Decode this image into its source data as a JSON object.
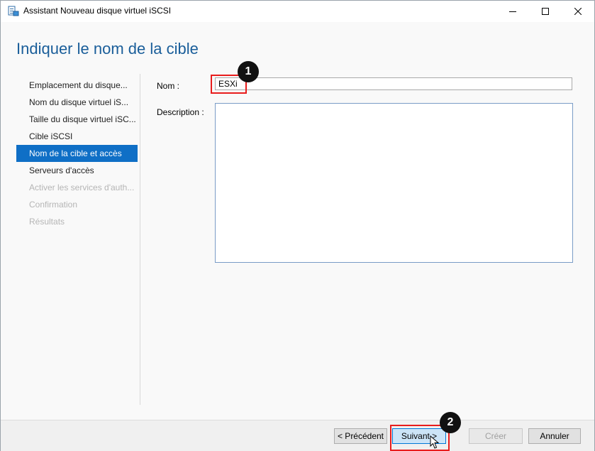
{
  "window": {
    "title": "Assistant Nouveau disque virtuel iSCSI",
    "icon": "iscsi-wizard-icon"
  },
  "page": {
    "title": "Indiquer le nom de la cible"
  },
  "sidebar": {
    "items": [
      {
        "label": "Emplacement du disque...",
        "state": "normal"
      },
      {
        "label": "Nom du disque virtuel iS...",
        "state": "normal"
      },
      {
        "label": "Taille du disque virtuel iSC...",
        "state": "normal"
      },
      {
        "label": "Cible iSCSI",
        "state": "normal"
      },
      {
        "label": "Nom de la cible et accès",
        "state": "active"
      },
      {
        "label": "Serveurs d'accès",
        "state": "normal"
      },
      {
        "label": "Activer les services d'auth...",
        "state": "disabled"
      },
      {
        "label": "Confirmation",
        "state": "disabled"
      },
      {
        "label": "Résultats",
        "state": "disabled"
      }
    ]
  },
  "form": {
    "name_label": "Nom :",
    "name_value": "ESXi",
    "description_label": "Description :",
    "description_value": ""
  },
  "annotations": {
    "step1": "1",
    "step2": "2",
    "color": "#e81c1c"
  },
  "footer": {
    "prev_label": "< Précédent",
    "next_label": "Suivant >",
    "create_label": "Créer",
    "cancel_label": "Annuler"
  },
  "colors": {
    "accent": "#0f6fc6",
    "title": "#1a5e9a"
  }
}
